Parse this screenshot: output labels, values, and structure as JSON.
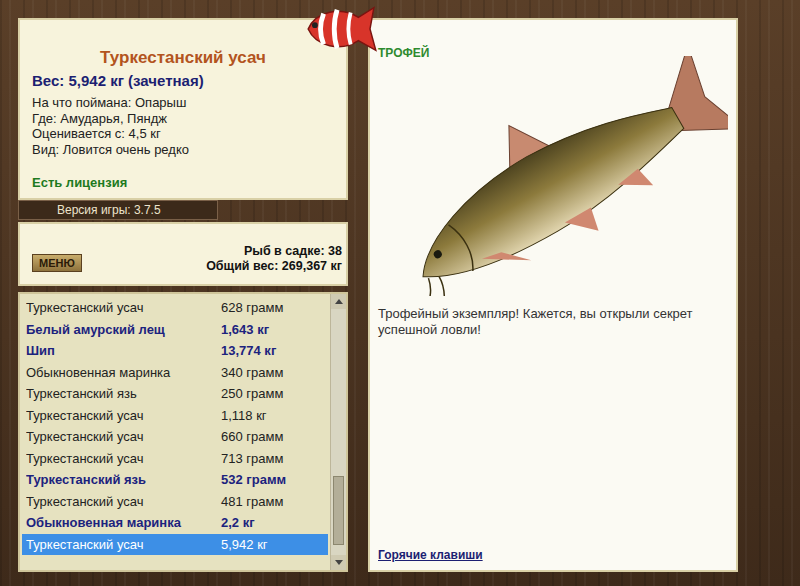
{
  "fish_card": {
    "title": "Туркестанский усач",
    "weight": "Вес: 5,942 кг (зачетная)",
    "details": [
      "На что поймана: Опарыш",
      "Где: Амударья, Пяндж",
      "Оценивается с: 4,5 кг",
      "Вид: Ловится очень редко"
    ],
    "license": "Есть лицензия"
  },
  "version": "Версия игры: 3.7.5",
  "menu_button": "МЕНЮ",
  "keepnet": {
    "count": "Рыб в садке: 38",
    "total": "Общий вес: 269,367 кг"
  },
  "catch_list": [
    {
      "name": "Туркестанский усач",
      "weight": "628 грамм",
      "trophy": false,
      "selected": false
    },
    {
      "name": "Белый амурский лещ",
      "weight": "1,643 кг",
      "trophy": true,
      "selected": false
    },
    {
      "name": "Шип",
      "weight": "13,774 кг",
      "trophy": true,
      "selected": false
    },
    {
      "name": "Обыкновенная маринка",
      "weight": "340 грамм",
      "trophy": false,
      "selected": false
    },
    {
      "name": "Туркестанский язь",
      "weight": "250 грамм",
      "trophy": false,
      "selected": false
    },
    {
      "name": "Туркестанский усач",
      "weight": "1,118 кг",
      "trophy": false,
      "selected": false
    },
    {
      "name": "Туркестанский усач",
      "weight": "660 грамм",
      "trophy": false,
      "selected": false
    },
    {
      "name": "Туркестанский усач",
      "weight": "713 грамм",
      "trophy": false,
      "selected": false
    },
    {
      "name": "Туркестанский язь",
      "weight": "532 грамм",
      "trophy": true,
      "selected": false
    },
    {
      "name": "Туркестанский усач",
      "weight": "481 грамм",
      "trophy": false,
      "selected": false
    },
    {
      "name": "Обыкновенная маринка",
      "weight": "2,2 кг",
      "trophy": true,
      "selected": false
    },
    {
      "name": "Туркестанский усач",
      "weight": "5,942 кг",
      "trophy": false,
      "selected": true
    }
  ],
  "scrollbar": {
    "thumb_from": 0.68,
    "thumb_to": 0.96
  },
  "trophy_panel": {
    "badge": "ТРОФЕЙ",
    "message": "Трофейный экземпляр! Кажется, вы открыли секрет успешной ловли!",
    "hotkeys_link": "Горячие клавиши"
  }
}
